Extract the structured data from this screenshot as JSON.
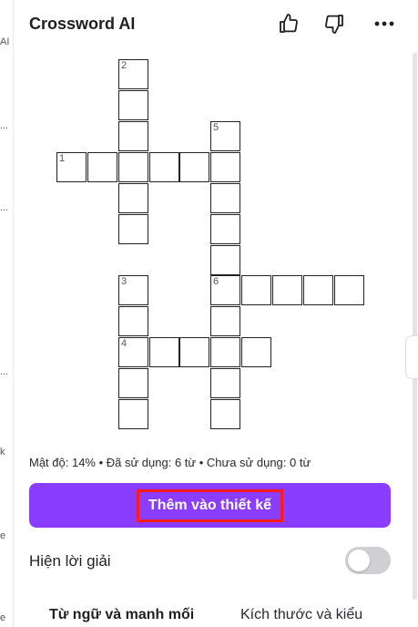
{
  "left_strip": {
    "fragments": [
      "AI",
      "...",
      "...",
      "...",
      "k",
      "e",
      "e"
    ]
  },
  "header": {
    "title": "Crossword AI",
    "icons": [
      "thumbs-up-icon",
      "thumbs-down-icon",
      "more-icon"
    ]
  },
  "crossword": {
    "clue_numbers": [
      "1",
      "2",
      "3",
      "4",
      "5",
      "6"
    ]
  },
  "stats": {
    "text": "Mật độ: 14% • Đã sử dụng: 6 từ • Chưa sử dụng: 0 từ"
  },
  "add_button": {
    "label": "Thêm vào thiết kế",
    "color": "#8b3dff"
  },
  "show_solution": {
    "label": "Hiện lời giải",
    "enabled": false
  },
  "tabs": [
    {
      "label": "Từ ngữ và manh mối",
      "active": true
    },
    {
      "label": "Kích thước và kiểu",
      "active": false
    }
  ]
}
